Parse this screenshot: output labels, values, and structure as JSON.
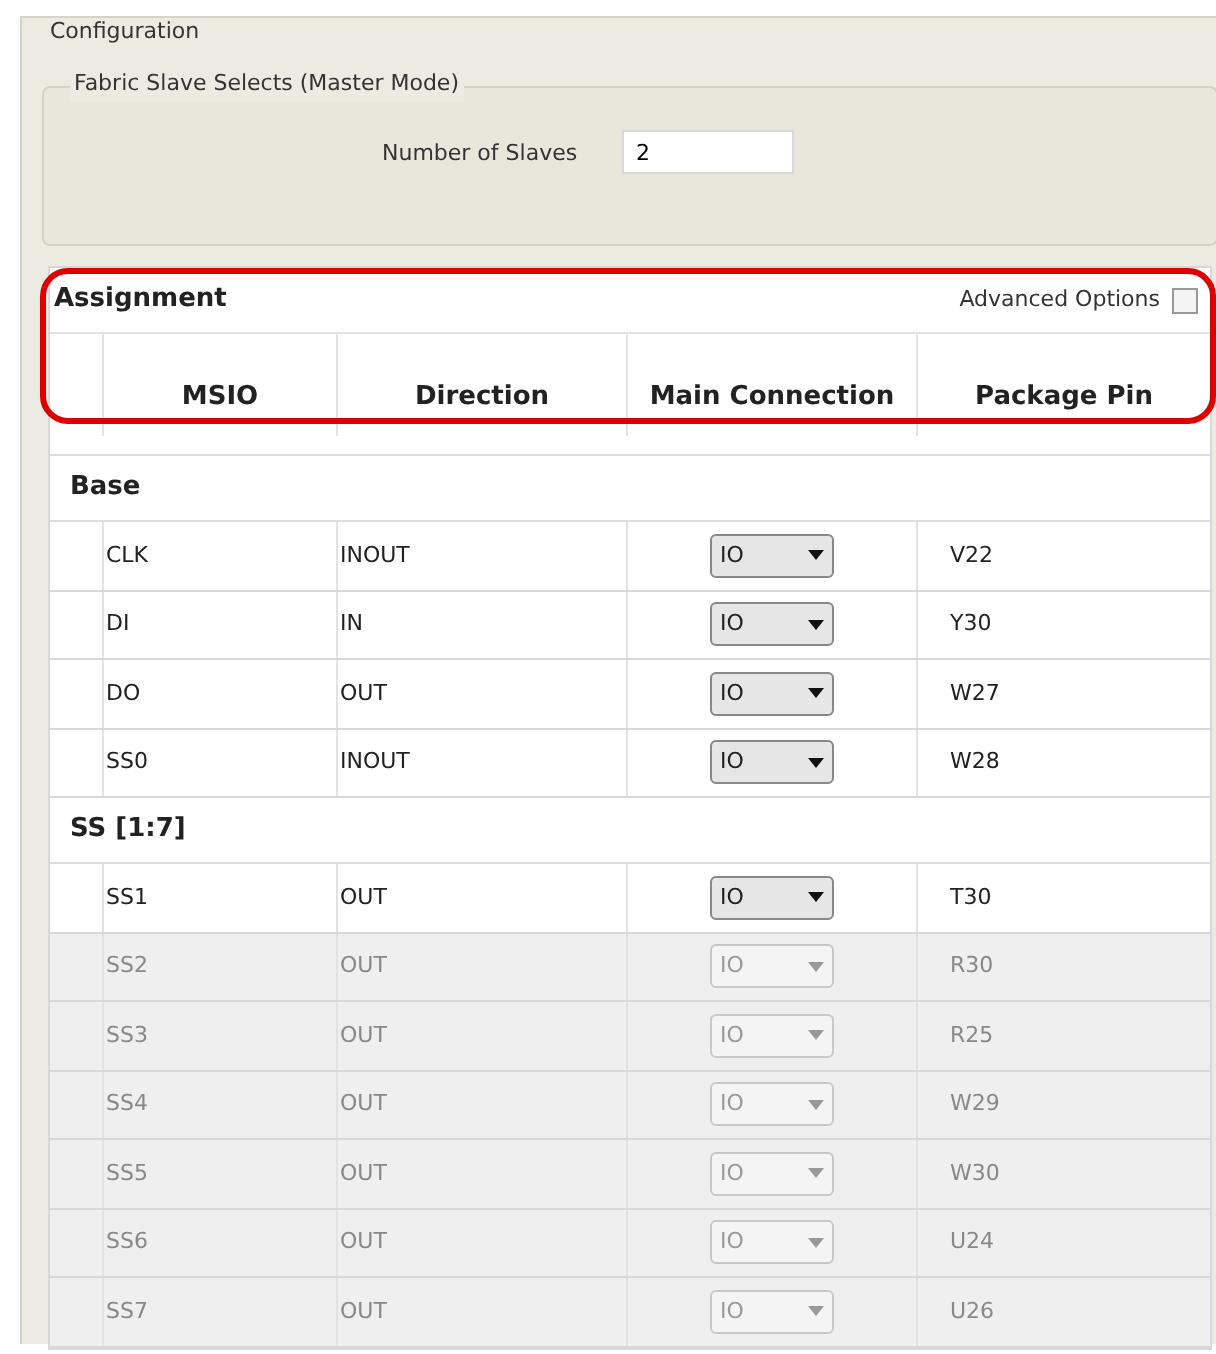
{
  "configuration": {
    "title": "Configuration",
    "fabric_group": {
      "title": "Fabric Slave Selects (Master Mode)",
      "field_label": "Number of Slaves",
      "field_value": "2"
    }
  },
  "assignment": {
    "title": "Assignment",
    "advanced_options": {
      "label": "Advanced Options",
      "checked": false
    },
    "columns": [
      "MSIO",
      "Direction",
      "Main Connection",
      "Package Pin"
    ],
    "sections": [
      {
        "title": "Base",
        "rows": [
          {
            "msio": "CLK",
            "direction": "INOUT",
            "connection": "IO",
            "pin": "V22",
            "disabled": false
          },
          {
            "msio": "DI",
            "direction": "IN",
            "connection": "IO",
            "pin": "Y30",
            "disabled": false
          },
          {
            "msio": "DO",
            "direction": "OUT",
            "connection": "IO",
            "pin": "W27",
            "disabled": false
          },
          {
            "msio": "SS0",
            "direction": "INOUT",
            "connection": "IO",
            "pin": "W28",
            "disabled": false
          }
        ]
      },
      {
        "title": "SS [1:7]",
        "rows": [
          {
            "msio": "SS1",
            "direction": "OUT",
            "connection": "IO",
            "pin": "T30",
            "disabled": false
          },
          {
            "msio": "SS2",
            "direction": "OUT",
            "connection": "IO",
            "pin": "R30",
            "disabled": true
          },
          {
            "msio": "SS3",
            "direction": "OUT",
            "connection": "IO",
            "pin": "R25",
            "disabled": true
          },
          {
            "msio": "SS4",
            "direction": "OUT",
            "connection": "IO",
            "pin": "W29",
            "disabled": true
          },
          {
            "msio": "SS5",
            "direction": "OUT",
            "connection": "IO",
            "pin": "W30",
            "disabled": true
          },
          {
            "msio": "SS6",
            "direction": "OUT",
            "connection": "IO",
            "pin": "U24",
            "disabled": true
          },
          {
            "msio": "SS7",
            "direction": "OUT",
            "connection": "IO",
            "pin": "U26",
            "disabled": true
          }
        ]
      }
    ]
  }
}
